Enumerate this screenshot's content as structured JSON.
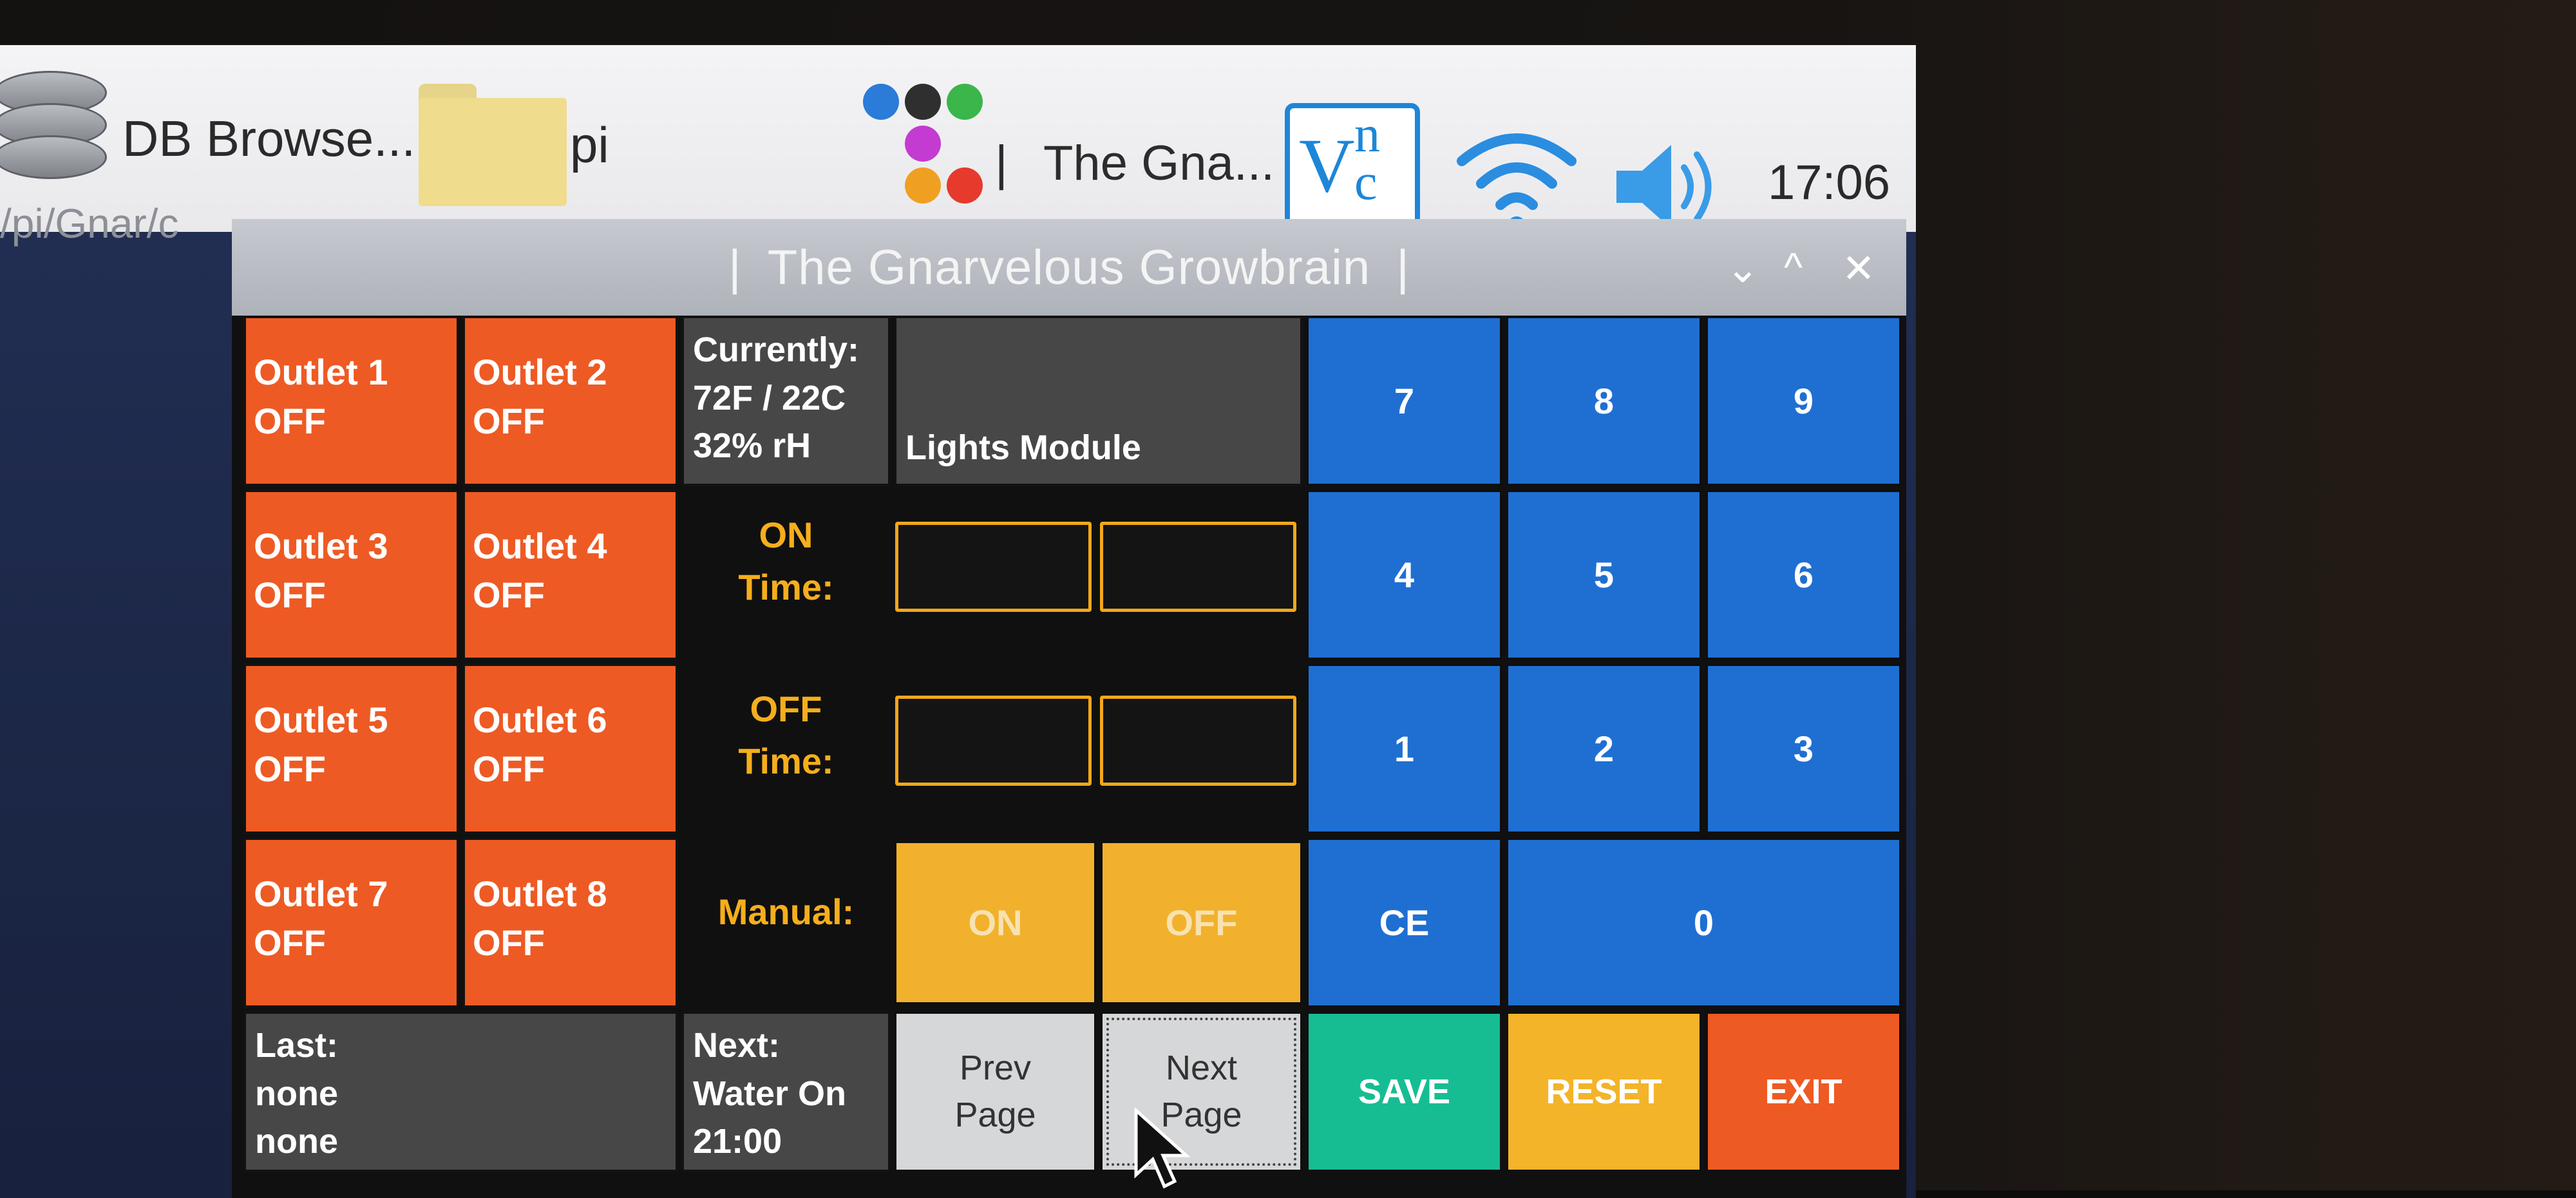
{
  "desktop": {
    "icons": [
      {
        "label": "DB Browse..."
      },
      {
        "label": "pi"
      }
    ],
    "path_text": "/pi/Gnar/c"
  },
  "taskbar": {
    "launcher_sep": "|",
    "window_title": "The Gna...",
    "clock": "17:06"
  },
  "window": {
    "title": "The Gnarvelous Growbrain",
    "title_prefix": "|",
    "title_suffix": "|",
    "controls": {
      "minimize": "⌄",
      "maximize": "^",
      "close": "✕"
    }
  },
  "outlets": [
    {
      "name": "Outlet 1",
      "state": "OFF"
    },
    {
      "name": "Outlet 2",
      "state": "OFF"
    },
    {
      "name": "Outlet 3",
      "state": "OFF"
    },
    {
      "name": "Outlet 4",
      "state": "OFF"
    },
    {
      "name": "Outlet 5",
      "state": "OFF"
    },
    {
      "name": "Outlet 6",
      "state": "OFF"
    },
    {
      "name": "Outlet 7",
      "state": "OFF"
    },
    {
      "name": "Outlet 8",
      "state": "OFF"
    }
  ],
  "status": {
    "current_label": "Currently:",
    "temperature": "72F / 22C",
    "humidity": "32% rH",
    "last_label": "Last:",
    "last_line1": "none",
    "last_line2": "none",
    "next_label": "Next:",
    "next_event": "Water On",
    "next_time": "21:00"
  },
  "module": {
    "title": "Lights Module",
    "on_label_1": "ON",
    "on_label_2": "Time:",
    "off_label_1": "OFF",
    "off_label_2": "Time:",
    "on_time_hours": "",
    "on_time_minutes": "",
    "off_time_hours": "",
    "off_time_minutes": "",
    "manual_label": "Manual:",
    "manual_on": "ON",
    "manual_off": "OFF"
  },
  "keypad": {
    "k7": "7",
    "k8": "8",
    "k9": "9",
    "k4": "4",
    "k5": "5",
    "k6": "6",
    "k1": "1",
    "k2": "2",
    "k3": "3",
    "ce": "CE",
    "k0": "0"
  },
  "nav": {
    "prev_1": "Prev",
    "prev_2": "Page",
    "next_1": "Next",
    "next_2": "Page",
    "save": "SAVE",
    "reset": "RESET",
    "exit": "EXIT"
  },
  "colors": {
    "outlet_off": "#ee5a24",
    "keypad_blue": "#1f6fd2",
    "accent_yellow": "#f2b12c",
    "save_green": "#16bd93",
    "info_grey": "#474747"
  },
  "icons": [
    "database-icon",
    "folder-icon",
    "launcher-icon",
    "vnc-icon",
    "wifi-icon",
    "volume-icon",
    "cursor-icon"
  ]
}
